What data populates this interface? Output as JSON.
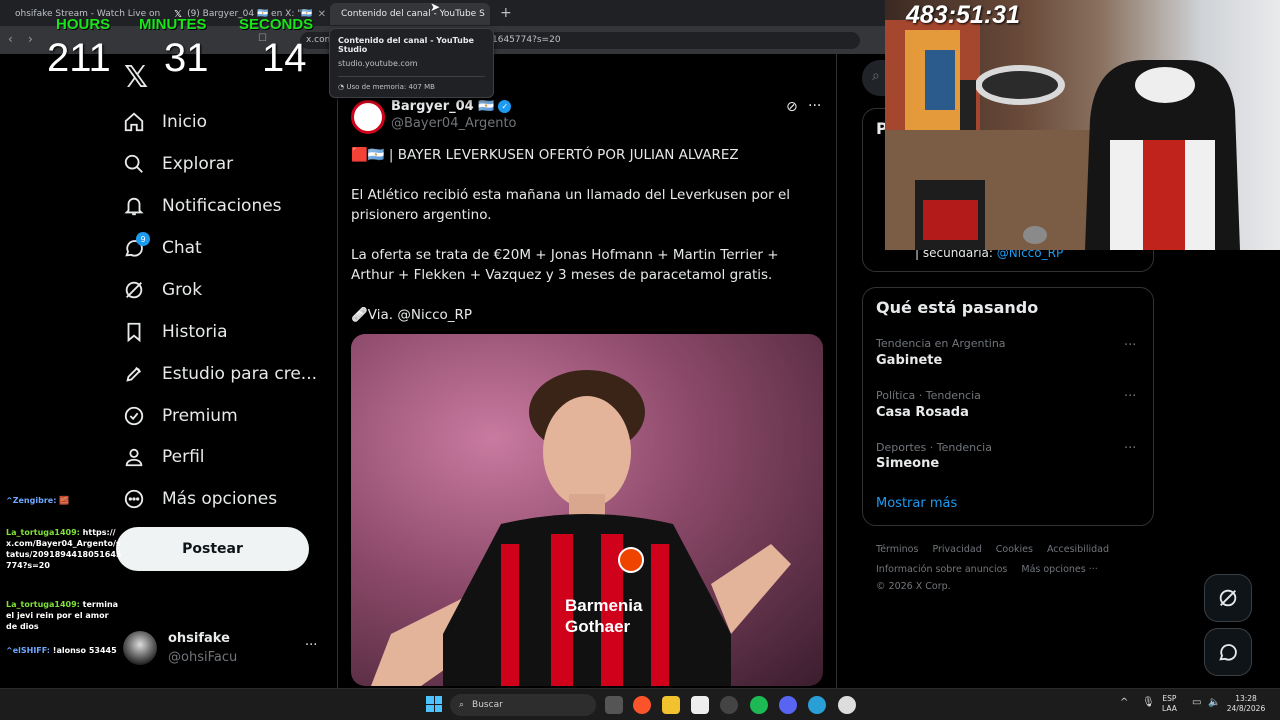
{
  "browser": {
    "tabs": [
      {
        "label": "ohsifake Stream - Watch Live on",
        "icon": "kick-icon"
      },
      {
        "label": "(9) Bargyer_04 🇦🇷 en X: \"🇦🇷",
        "icon": "x-icon"
      },
      {
        "label": "Contenido del canal - YouTube S",
        "icon": "youtube-icon"
      }
    ],
    "url": "x.com/Bayer04_Argento/status/2091894418051645774?s=20",
    "url_visible": "x.com",
    "url_tail": "1645774?s=20",
    "tooltip": {
      "title": "Contenido del canal - YouTube Studio",
      "domain": "studio.youtube.com",
      "memory": "Uso de memoria: 407 MB"
    }
  },
  "countdown": {
    "hours_label": "HOURS",
    "minutes_label": "MINUTES",
    "seconds_label": "SECONDS",
    "hours": "211",
    "minutes": "31",
    "seconds": "14"
  },
  "webcam": {
    "timer": "483:51:31",
    "colors": {
      "chair_red": "#c0221c"
    }
  },
  "nav": {
    "items": [
      {
        "label": "Inicio",
        "icon": "home-icon"
      },
      {
        "label": "Explorar",
        "icon": "search-icon"
      },
      {
        "label": "Notificaciones",
        "icon": "bell-icon"
      },
      {
        "label": "Chat",
        "icon": "chat-icon",
        "badge": "9"
      },
      {
        "label": "Grok",
        "icon": "grok-icon"
      },
      {
        "label": "Historia",
        "icon": "bookmark-icon"
      },
      {
        "label": "Estudio para cre...",
        "icon": "rocket-icon"
      },
      {
        "label": "Premium",
        "icon": "verified-icon"
      },
      {
        "label": "Perfil",
        "icon": "person-icon"
      },
      {
        "label": "Más opciones",
        "icon": "more-circle-icon"
      }
    ],
    "post_button": "Postear",
    "profile": {
      "name": "ohsifake",
      "handle": "@ohsiFacu",
      "more": "···"
    }
  },
  "chat_messages": [
    {
      "user": "^Zengibre:",
      "text": "🧱"
    },
    {
      "user": "La_tortuga1409:",
      "text": "https://x.com/Bayer04_Argento/status/2091894418051645774?s=20"
    },
    {
      "user": "La_tortuga1409:",
      "text": "termina el jevi rein por el amor de dios"
    },
    {
      "user": "^elSHIFF:",
      "text": "!alonso 53445"
    }
  ],
  "tweet": {
    "author": "Bargyer_04 🇦🇷",
    "handle": "@Bayer04_Argento",
    "headline": "🟥🇦🇷 | BAYER LEVERKUSEN OFERTÓ POR JULIAN ALVAREZ",
    "para1": "El Atlético recibió esta mañana un llamado del Leverkusen por el prisionero argentino.",
    "para2": "La oferta se trata de €20M + Jonas Hofmann + Martin Terrier + Arthur + Flekken + Vazquez y 3 meses de paracetamol gratis.",
    "para3": "🩹Via. @Nicco_RP",
    "image_text": {
      "sponsor1": "Barmenia",
      "sponsor2": "Gothaer"
    },
    "colors": {
      "verified": "#1d9bf0",
      "shirt_red": "#d0021b"
    }
  },
  "right": {
    "card1_letter": "P",
    "card1_footer": "| secundaria:",
    "card1_link": "@Nicco_RP",
    "trending_title": "Qué está pasando",
    "trends": [
      {
        "meta": "Tendencia en Argentina",
        "name": "Gabinete"
      },
      {
        "meta": "Política · Tendencia",
        "name": "Casa Rosada"
      },
      {
        "meta": "Deportes · Tendencia",
        "name": "Simeone"
      }
    ],
    "show_more": "Mostrar más",
    "footer": [
      "Términos",
      "Privacidad",
      "Cookies",
      "Accesibilidad",
      "Información sobre anuncios",
      "Más opciones ···",
      "© 2026 X Corp."
    ]
  },
  "taskbar": {
    "search_placeholder": "Buscar",
    "lang1": "ESP",
    "lang2": "LAA",
    "time": "13:28",
    "date": "24/8/2026"
  }
}
